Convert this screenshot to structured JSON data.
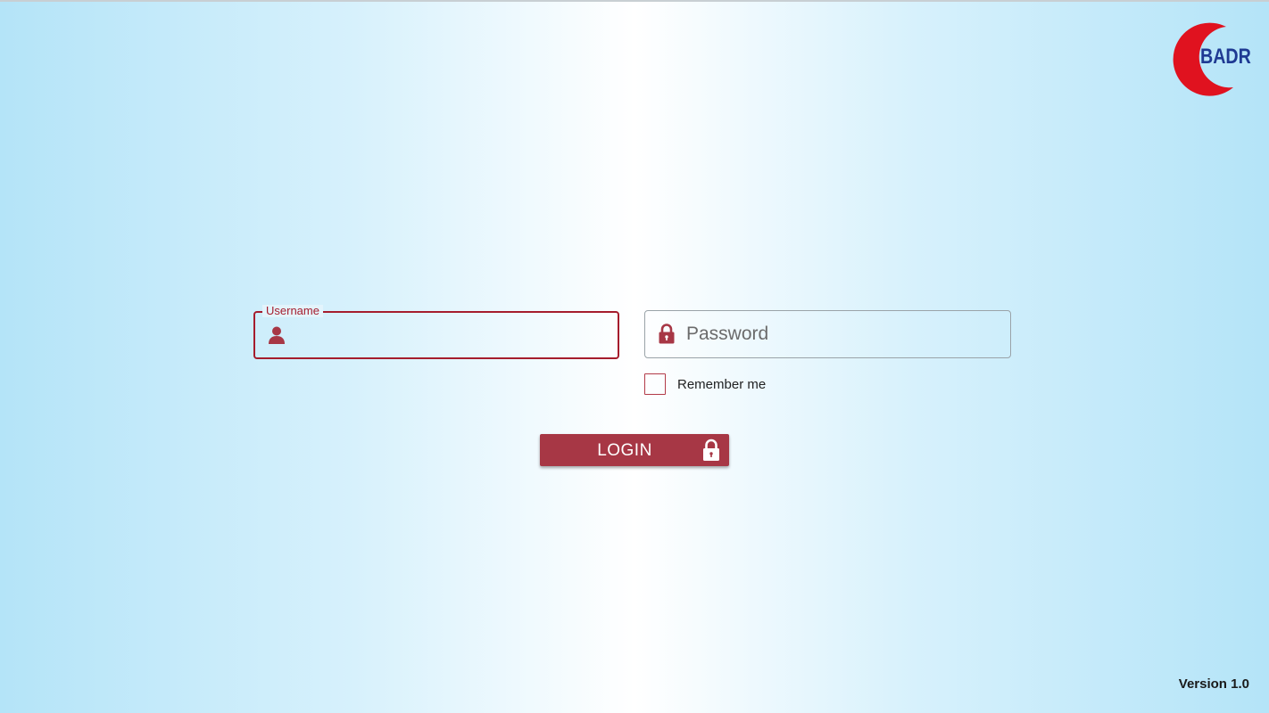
{
  "logo": {
    "text": "BADR",
    "crescent_color": "#e0121f",
    "text_color": "#1f3a93",
    "icon": "red-crescent-logo"
  },
  "login_form": {
    "username": {
      "label": "Username",
      "value": "",
      "icon": "user-icon",
      "focused": true
    },
    "password": {
      "placeholder": "Password",
      "value": "",
      "icon": "lock-icon"
    },
    "remember_me": {
      "label": "Remember me",
      "checked": false
    },
    "login_button": {
      "label": "LOGIN",
      "icon": "lock-icon"
    }
  },
  "footer": {
    "version": "Version  1.0"
  },
  "colors": {
    "accent": "#a73745",
    "focus_border": "#a51d2d",
    "background_edge": "#b4e4f8",
    "background_center": "#ffffff"
  }
}
